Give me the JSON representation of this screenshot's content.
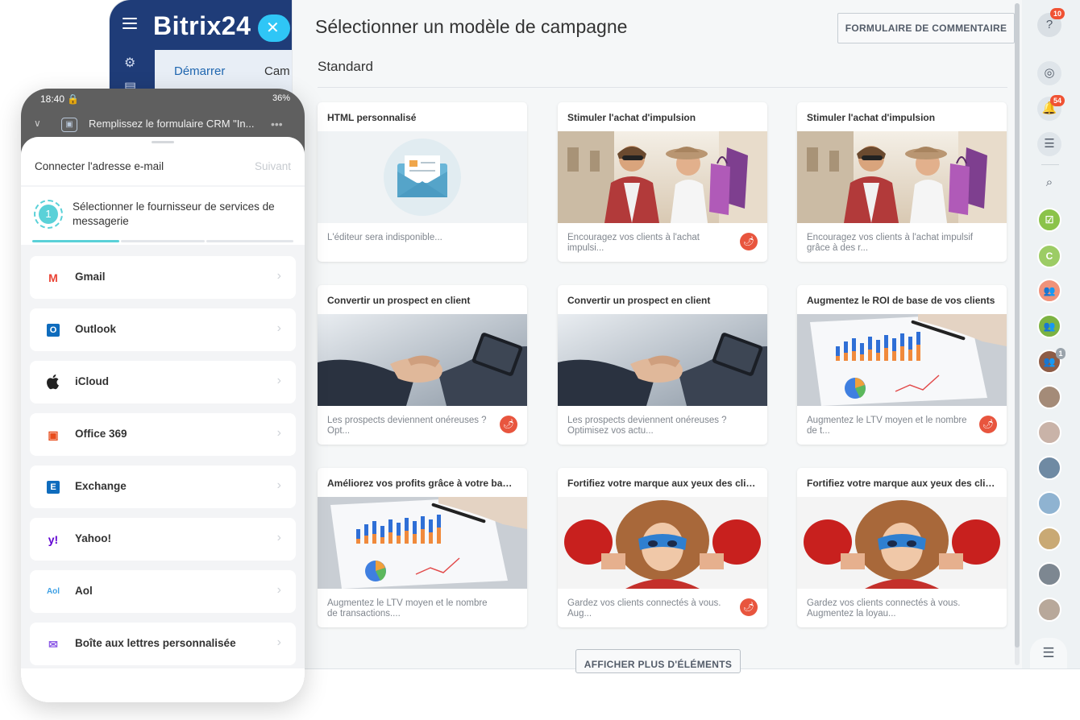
{
  "bitrix": {
    "logo": "Bitrix24",
    "close_glyph": "✕",
    "tabs": [
      "Démarrer",
      "Cam"
    ]
  },
  "panel": {
    "title": "Sélectionner un modèle de campagne",
    "feedback_button": "FORMULAIRE DE COMMENTAIRE",
    "section": "Standard",
    "show_more": "AFFICHER PLUS D'ÉLÉMENTS",
    "cards": [
      {
        "title": "HTML personnalisé",
        "desc": "L'éditeur sera indisponible...",
        "image": "envelope",
        "hot": false
      },
      {
        "title": "Stimuler l'achat d'impulsion",
        "desc": "Encouragez vos clients à l'achat impulsi...",
        "image": "shopping-couple",
        "hot": true
      },
      {
        "title": "Stimuler l'achat d'impulsion",
        "desc": "Encouragez vos clients à l'achat impulsif grâce à des r...",
        "image": "shopping-couple",
        "hot": false
      },
      {
        "title": "Convertir un prospect en client",
        "desc": "Les prospects deviennent onéreuses ? Opt...",
        "image": "handshake",
        "hot": true
      },
      {
        "title": "Convertir un prospect en client",
        "desc": "Les prospects deviennent onéreuses ? Optimisez vos actu...",
        "image": "handshake",
        "hot": false
      },
      {
        "title": "Augmentez le ROI de base de vos clients",
        "desc": "Augmentez le LTV moyen et le nombre de t...",
        "image": "bar-chart-paper",
        "hot": true
      },
      {
        "title": "Améliorez vos profits grâce à votre base...",
        "desc": "Augmentez le LTV moyen et le nombre de transactions....",
        "image": "bar-chart-paper",
        "hot": false
      },
      {
        "title": "Fortifiez votre marque aux yeux des clie...",
        "desc": "Gardez vos clients connectés à vous. Aug...",
        "image": "superhero-kid",
        "hot": true
      },
      {
        "title": "Fortifiez votre marque aux yeux des clie...",
        "desc": "Gardez vos clients connectés à vous. Augmentez la loyau...",
        "image": "superhero-kid",
        "hot": false
      }
    ]
  },
  "rightbar": {
    "help_badge": "10",
    "notif_badge": "54",
    "group_badge": "1",
    "avatar_letter": "C"
  },
  "phone": {
    "time": "18:40",
    "battery": "36%",
    "notification": "Remplissez le formulaire CRM \"In...",
    "sheet_title": "Connecter l'adresse e-mail",
    "next": "Suivant",
    "step_number": "1",
    "step_text": "Sélectionner le fournisseur de services de messagerie",
    "providers": [
      {
        "label": "Gmail",
        "icon": "gmail-icon",
        "color": "#ea4335"
      },
      {
        "label": "Outlook",
        "icon": "outlook-icon",
        "color": "#0f6cbd"
      },
      {
        "label": "iCloud",
        "icon": "apple-icon",
        "color": "#333333"
      },
      {
        "label": "Office 369",
        "icon": "office-icon",
        "color": "#e84d1c"
      },
      {
        "label": "Exchange",
        "icon": "exchange-icon",
        "color": "#0f6cbd"
      },
      {
        "label": "Yahoo!",
        "icon": "yahoo-icon",
        "color": "#6001d2"
      },
      {
        "label": "Aol",
        "icon": "aol-icon",
        "color": "#3ea0e4"
      },
      {
        "label": "Boîte aux lettres personnalisée",
        "icon": "mail-icon",
        "color": "#8e5ce6"
      }
    ]
  }
}
